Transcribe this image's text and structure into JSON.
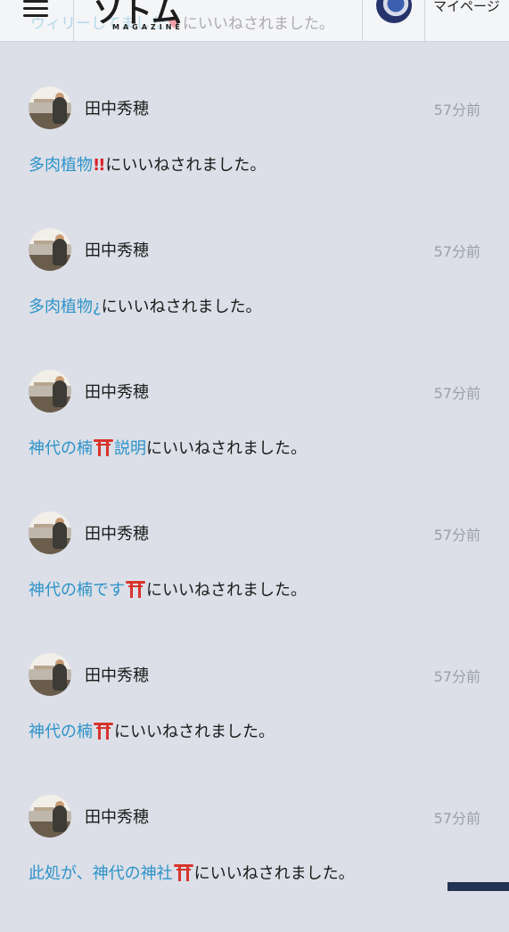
{
  "header": {
    "logo_text": "ソトム",
    "logo_sub": "MAGAZINE",
    "mypage_label": "マイページ",
    "ghost_notice": {
      "title": "ウィリーしてました",
      "suffix": "にいいねされました。"
    }
  },
  "notifications": [
    {
      "user": "田中秀穂",
      "time": "57分前",
      "title": "多肉植物",
      "icon": "double-exclamation-icon",
      "title_after": "",
      "suffix": "にいいねされました。"
    },
    {
      "user": "田中秀穂",
      "time": "57分前",
      "title": "多肉植物¿",
      "icon": "",
      "title_after": "",
      "suffix": "にいいねされました。"
    },
    {
      "user": "田中秀穂",
      "time": "57分前",
      "title": "神代の楠",
      "icon": "torii-icon",
      "title_after": "説明",
      "suffix": "にいいねされました。"
    },
    {
      "user": "田中秀穂",
      "time": "57分前",
      "title": "神代の楠です",
      "icon": "torii-icon",
      "title_after": "",
      "suffix": "にいいねされました。"
    },
    {
      "user": "田中秀穂",
      "time": "57分前",
      "title": "神代の楠",
      "icon": "torii-icon",
      "title_after": "",
      "suffix": "にいいねされました。"
    },
    {
      "user": "田中秀穂",
      "time": "57分前",
      "title": "此処が、神代の神社",
      "icon": "torii-icon",
      "title_after": "",
      "suffix": "にいいねされました。"
    }
  ],
  "colors": {
    "background": "#dcdfe7",
    "link": "#2c93c9",
    "time": "#9aa0ab",
    "torii": "#d8332b"
  }
}
